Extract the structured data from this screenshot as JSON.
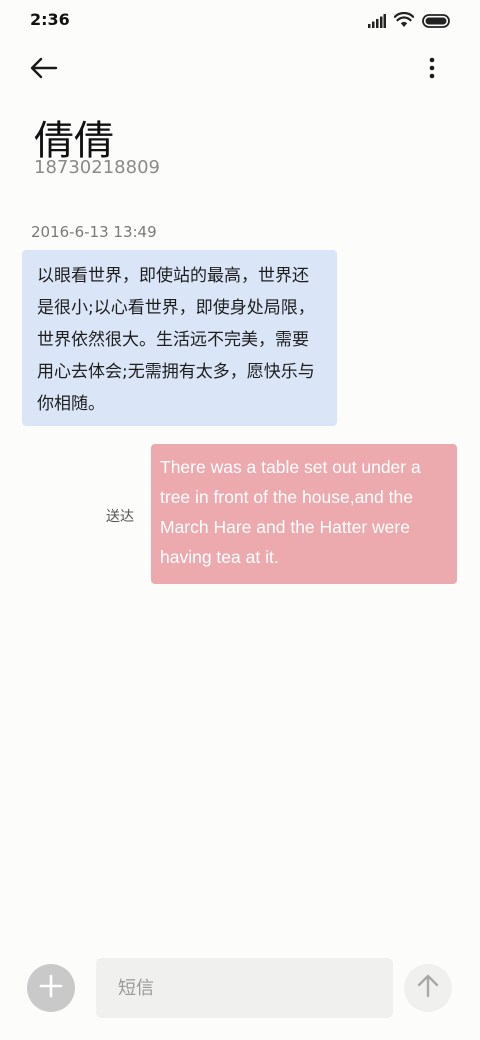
{
  "status_bar": {
    "time": "2:36",
    "icons": [
      "signal-icon",
      "wifi-icon",
      "battery-icon"
    ]
  },
  "toolbar": {
    "back_icon": "back-arrow-icon",
    "more_icon": "more-vertical-icon"
  },
  "contact": {
    "name": "倩倩",
    "number": "18730218809"
  },
  "conversation": {
    "timestamp": "2016-6-13 13:49",
    "messages": [
      {
        "direction": "incoming",
        "text": "以眼看世界，即使站的最高，世界还是很小;以心看世界，即使身处局限，世界依然很大。生活远不完美，需要用心去体会;无需拥有太多，愿快乐与你相随。",
        "color": "#dbe5f8"
      },
      {
        "direction": "outgoing",
        "text": "There was a table set out under a tree in front of the house,and the March Hare and the Hatter were having tea at it.",
        "status": "送达",
        "color": "#eca9ae"
      }
    ]
  },
  "composer": {
    "placeholder": "短信",
    "value": "",
    "add_icon": "plus-icon",
    "send_icon": "arrow-up-icon"
  }
}
